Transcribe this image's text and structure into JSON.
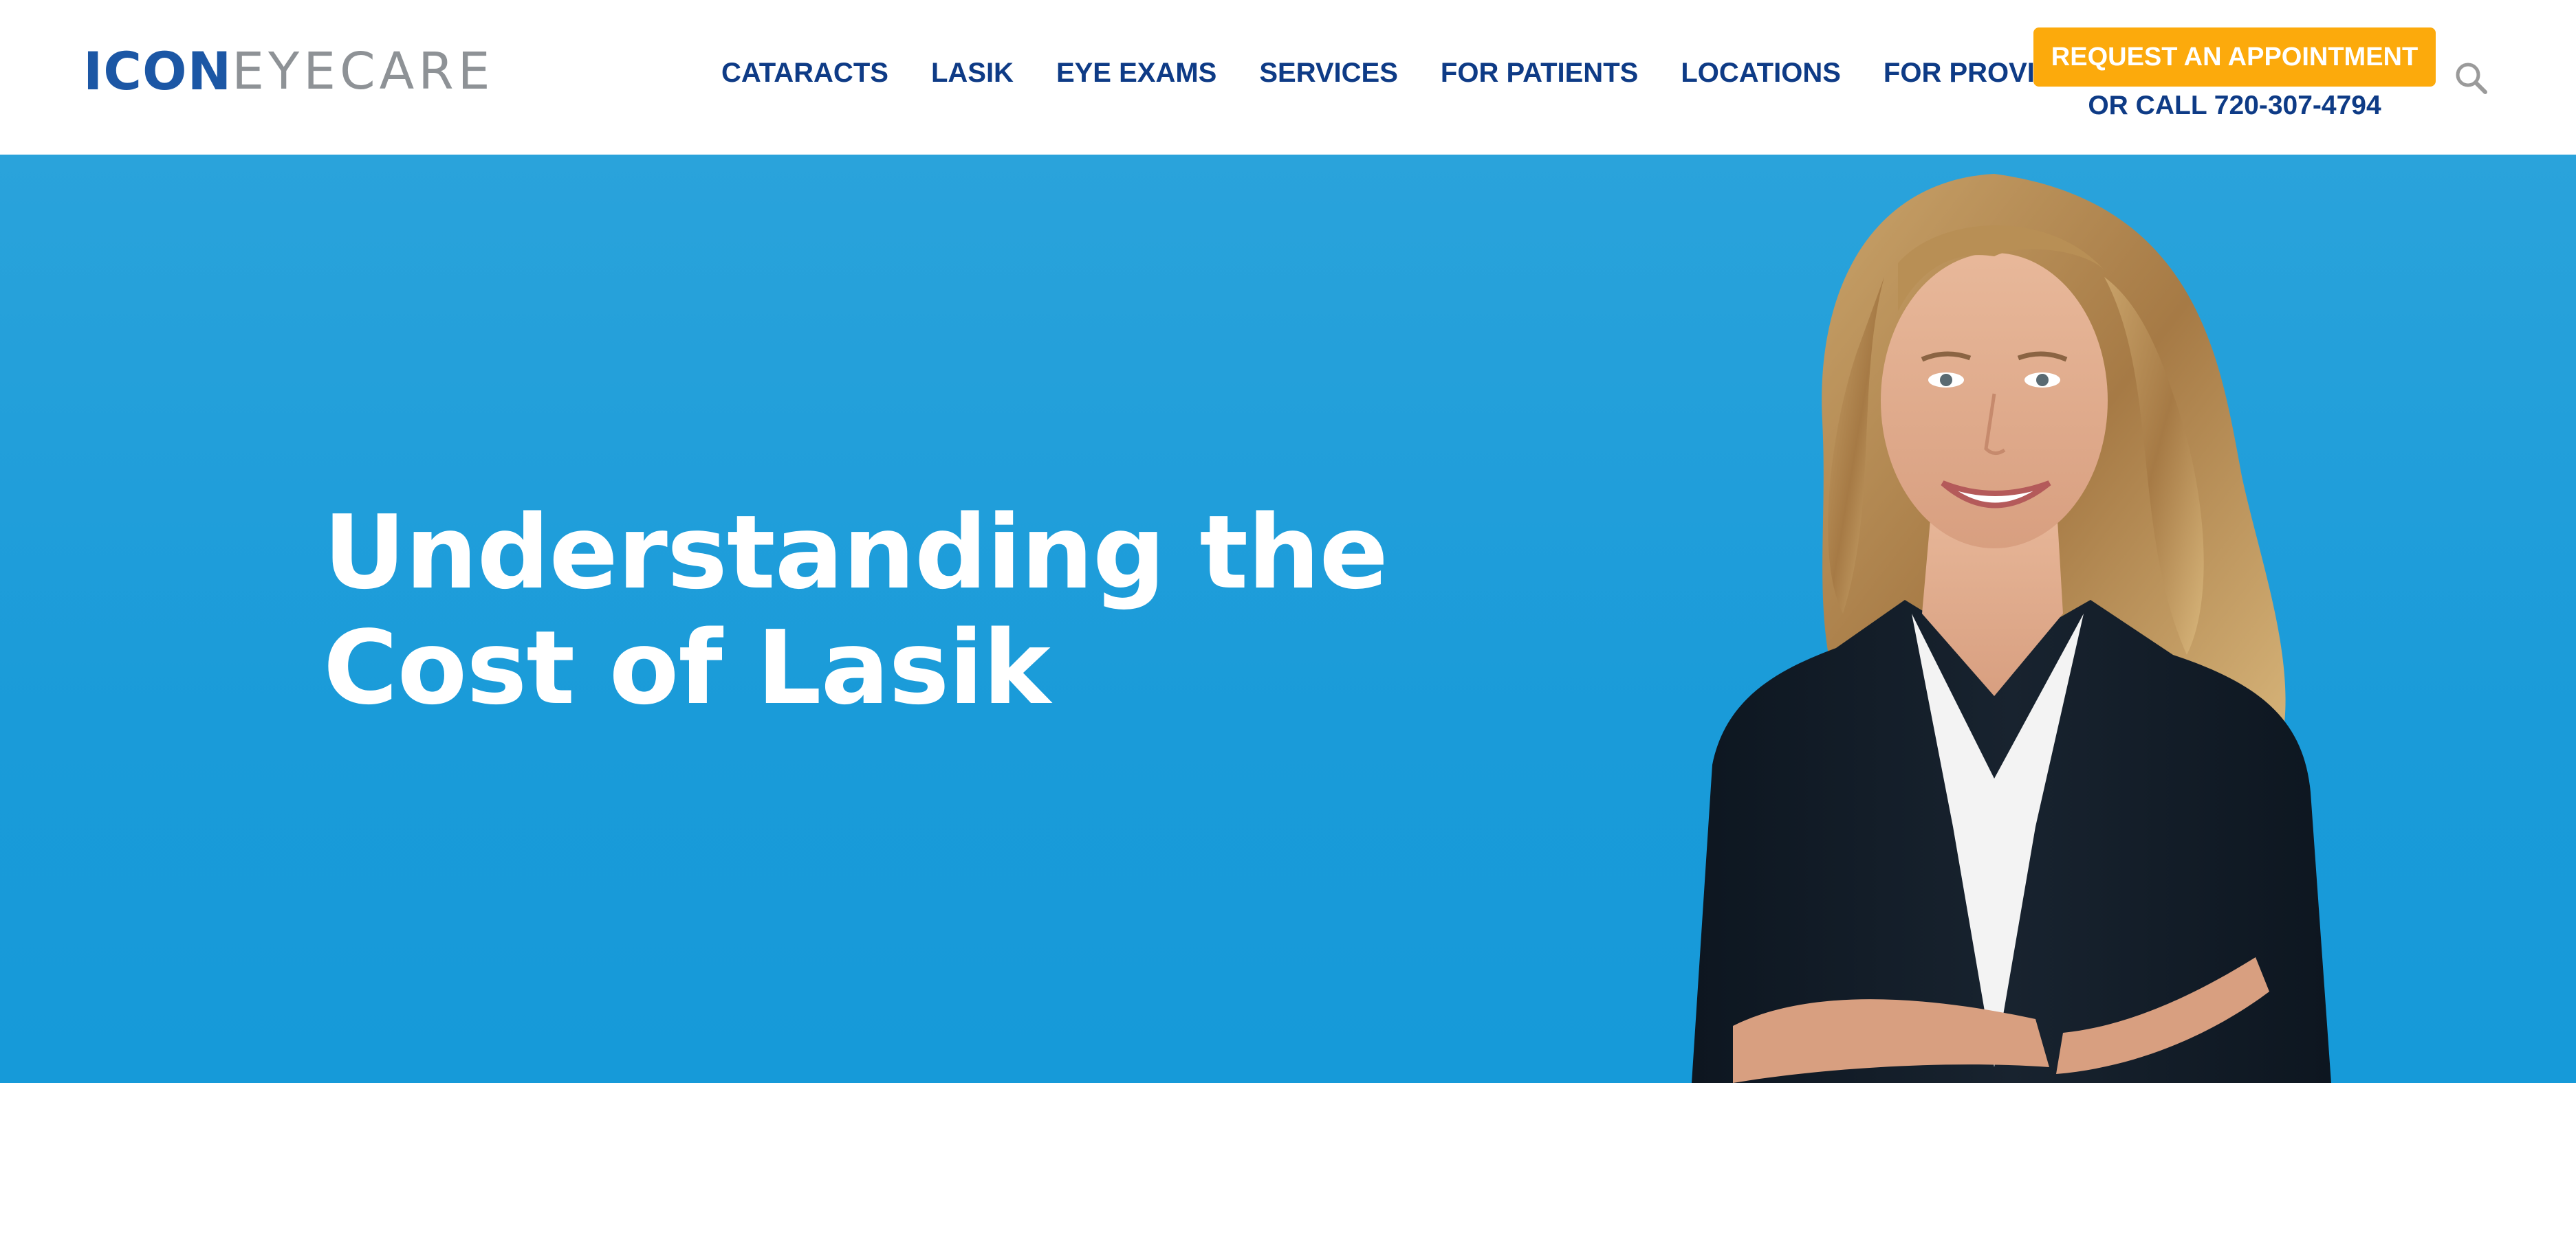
{
  "brand": {
    "logo_primary": "ICON",
    "logo_secondary": "EYECARE",
    "primary_color": "#1c57a5",
    "secondary_color": "#8e9296"
  },
  "nav": {
    "items": [
      {
        "label": "CATARACTS"
      },
      {
        "label": "LASIK"
      },
      {
        "label": "EYE EXAMS"
      },
      {
        "label": "SERVICES"
      },
      {
        "label": "FOR PATIENTS"
      },
      {
        "label": "LOCATIONS"
      },
      {
        "label": "FOR PROVIDERS"
      }
    ],
    "color": "#0e3b86"
  },
  "cta": {
    "button_label": "REQUEST AN APPOINTMENT",
    "phone_text": "OR CALL 720-307-4794",
    "button_color": "#fcaa0c"
  },
  "search": {
    "icon": "search-icon"
  },
  "hero": {
    "title_line1": "Understanding the",
    "title_line2": "Cost of Lasik",
    "background_color": "#1a9bd9",
    "image": "woman-portrait"
  }
}
